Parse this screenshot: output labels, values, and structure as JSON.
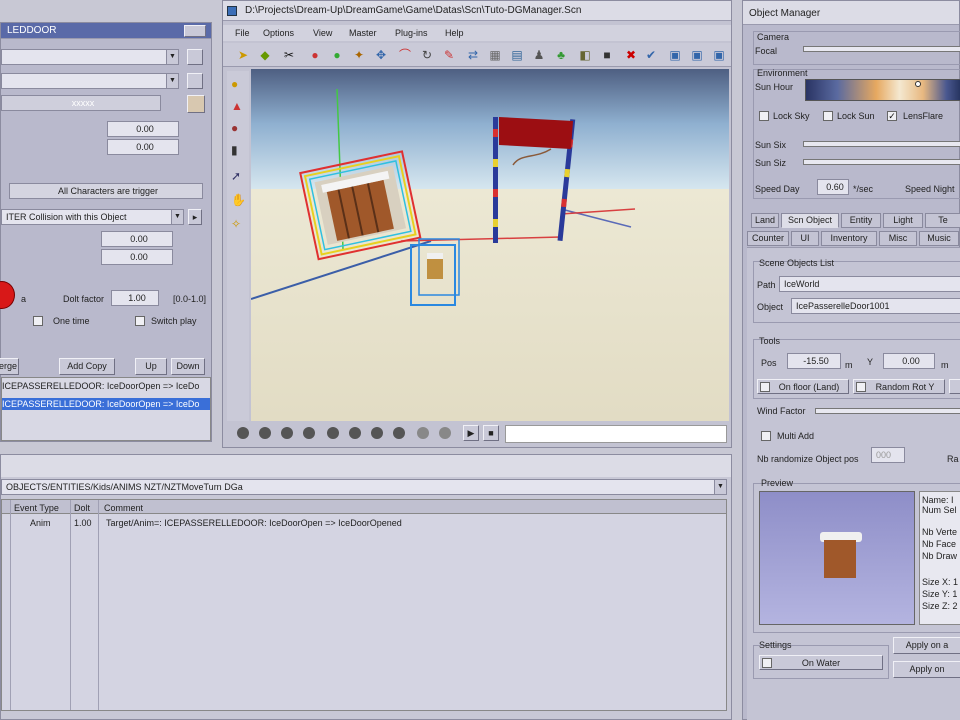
{
  "left_panel": {
    "title": "LEDDOOR",
    "field_a": "",
    "field_b": "",
    "field_c": "xxxxx",
    "value_1": "0.00",
    "value_2": "0.00",
    "trigger_label": "All Characters are trigger",
    "collision_select": "ITER Collision with this Object",
    "value_3": "0.00",
    "value_4": "0.00",
    "dolt_factor_label": "Dolt factor",
    "dolt_factor_value": "1.00",
    "dolt_factor_range": "[0.0-1.0]",
    "one_time_label": "One time",
    "switch_play_label": "Switch play",
    "merge_label": "erge",
    "add_copy_label": "Add Copy",
    "up_label": "Up",
    "down_label": "Down",
    "list_items": [
      "ICEPASSERELLEDOOR: IceDoorOpen => IceDo",
      "ICEPASSERELLEDOOR: IceDoorOpen => IceDo"
    ]
  },
  "viewport_window": {
    "title": "D:\\Projects\\Dream-Up\\DreamGame\\Game\\Datas\\Scn\\Tuto-DGManager.Scn",
    "menu": [
      "File",
      "Options",
      "View",
      "Master",
      "Plug-ins",
      "Help"
    ]
  },
  "bottom_panel": {
    "path": "OBJECTS/ENTITIES/Kids/ANIMS NZT/NZTMoveTurn DGa",
    "columns": [
      "Event Type",
      "Dolt",
      "Comment"
    ],
    "rows": [
      {
        "type": "Anim",
        "dolt": "1.00",
        "comment": "Target/Anim=: ICEPASSERELLEDOOR: IceDoorOpen => IceDoorOpened"
      }
    ]
  },
  "object_manager": {
    "title": "Object Manager",
    "camera_label": "Camera",
    "focal_label": "Focal",
    "environment_label": "Environment",
    "sun_hour_label": "Sun Hour",
    "lock_sky_label": "Lock Sky",
    "lock_sun_label": "Lock Sun",
    "lens_flare_label": "LensFlare",
    "sun_six_label": "Sun Six",
    "sun_six2_label": "Sun Siz",
    "speed_day_label": "Speed Day",
    "speed_day_value": "0.60",
    "speed_unit": "*/sec",
    "speed_night_label": "Speed Night",
    "tabs_row1": [
      "Land",
      "Scn Object",
      "Entity",
      "Light",
      "Te"
    ],
    "tabs_row2": [
      "Counter",
      "UI",
      "Inventory",
      "Misc",
      "Music"
    ],
    "scene_objects_label": "Scene Objects List",
    "path_label": "Path",
    "path_value": "IceWorld",
    "object_label": "Object",
    "object_value": "IcePasserelleDoor1001",
    "tools_label": "Tools",
    "pos_label": "Pos",
    "pos_x": "-15.50",
    "y_label": "Y",
    "pos_y": "0.00",
    "on_floor_label": "On floor (Land)",
    "random_rot_label": "Random Rot Y",
    "wind_factor_label": "Wind Factor",
    "multi_add_label": "Multi Add",
    "nb_randomize_label": "Nb randomize Object pos",
    "nb_randomize_value": "000",
    "ra_label": "Ra",
    "preview_label": "Preview",
    "info_lines": [
      "Name: I",
      "Num Sel",
      "",
      "Nb Verte",
      "Nb Face",
      "Nb Draw",
      "",
      "Size X: 1",
      "Size Y: 1",
      "Size Z: 2"
    ],
    "settings_label": "Settings",
    "on_water_label": "On Water",
    "apply_on_label": "Apply on a",
    "apply_on2_label": "Apply on"
  },
  "colors": {
    "panel_bg": "#b9b9cc",
    "selection": "#3a6fd8",
    "sky_top": "#6c8cb4",
    "floor": "#e6e2cc"
  }
}
